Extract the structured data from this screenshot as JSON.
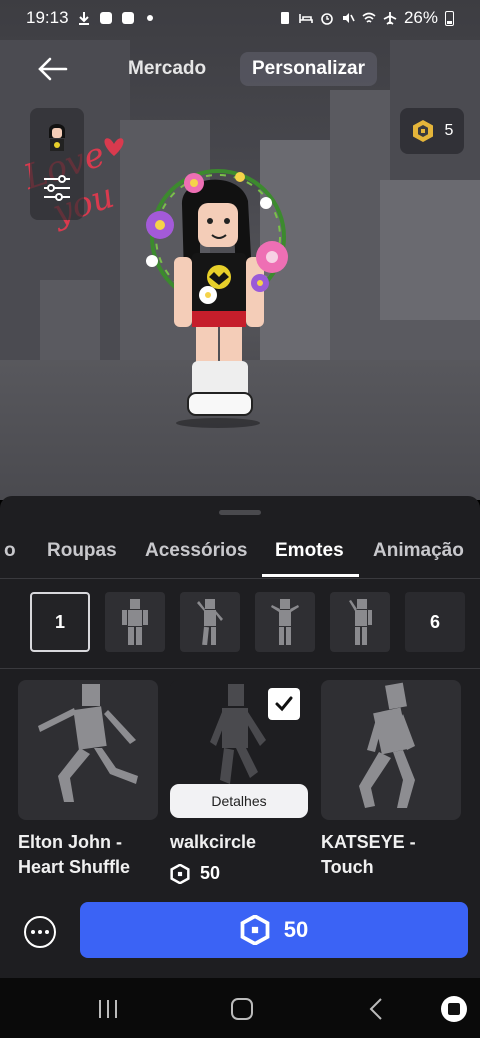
{
  "status_bar": {
    "time": "19:13",
    "battery": "26%"
  },
  "nav": {
    "tab_market": "Mercado",
    "tab_customize": "Personalizar"
  },
  "robux": {
    "balance": "5"
  },
  "decor": {
    "handwriting_line1": "Love",
    "handwriting_line2": "you"
  },
  "categories": {
    "partial": "o",
    "items": [
      "Roupas",
      "Acessórios",
      "Emotes",
      "Animação"
    ],
    "active": "Emotes"
  },
  "slots": {
    "first": "1",
    "last": "6"
  },
  "items": [
    {
      "name_line1": "Elton John -",
      "name_line2": "Heart Shuffle"
    },
    {
      "name_line1": "walkcircle",
      "price": "50",
      "checked": true,
      "details_label": "Detalhes"
    },
    {
      "name_line1": "KATSEYE -",
      "name_line2": "Touch"
    }
  ],
  "buy_button": {
    "price": "50"
  },
  "colors": {
    "accent": "#3b63f5",
    "sheet_bg": "#1e1e21"
  }
}
